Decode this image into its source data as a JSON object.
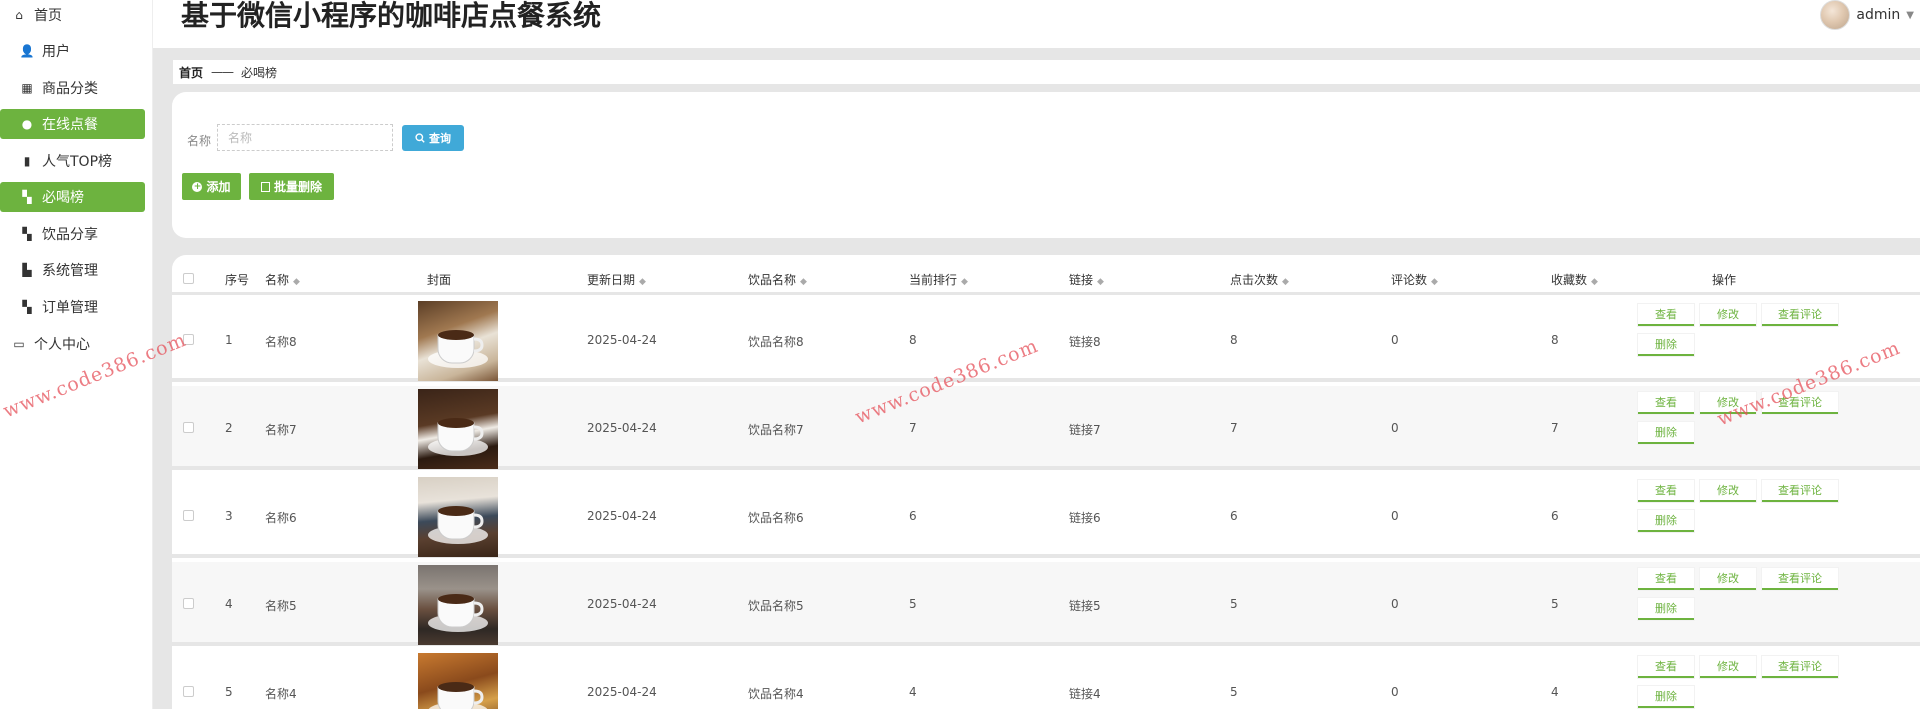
{
  "app_title": "基于微信小程序的咖啡店点餐系统",
  "user": {
    "name": "admin"
  },
  "sidebar": {
    "items": [
      {
        "label": "首页",
        "icon": "home-icon",
        "glyph": "⌂",
        "level": "top",
        "active": false
      },
      {
        "label": "用户",
        "icon": "user-icon",
        "glyph": "👤",
        "level": "sub",
        "active": false
      },
      {
        "label": "商品分类",
        "icon": "grid-icon",
        "glyph": "▦",
        "level": "sub",
        "active": false
      },
      {
        "label": "在线点餐",
        "icon": "pin-icon",
        "glyph": "●",
        "level": "sub",
        "active": true
      },
      {
        "label": "人气TOP榜",
        "icon": "bar-chart-icon",
        "glyph": "▮",
        "level": "sub",
        "active": false
      },
      {
        "label": "必喝榜",
        "icon": "tiles-icon",
        "glyph": "▚",
        "level": "sub",
        "active": true
      },
      {
        "label": "饮品分享",
        "icon": "tiles-icon",
        "glyph": "▚",
        "level": "sub",
        "active": false
      },
      {
        "label": "系统管理",
        "icon": "chart-icon",
        "glyph": "▙",
        "level": "sub",
        "active": false
      },
      {
        "label": "订单管理",
        "icon": "tiles-icon",
        "glyph": "▚",
        "level": "sub",
        "active": false
      },
      {
        "label": "个人中心",
        "icon": "card-icon",
        "glyph": "▭",
        "level": "top",
        "active": false
      }
    ]
  },
  "breadcrumb": {
    "home": "首页",
    "separator": "——",
    "current": "必喝榜"
  },
  "search": {
    "label": "名称",
    "placeholder": "名称",
    "button": "查询"
  },
  "actions": {
    "add": "添加",
    "bulk_delete": "批量删除"
  },
  "table": {
    "headers": {
      "index": "序号",
      "name": "名称",
      "cover": "封面",
      "date": "更新日期",
      "drink": "饮品名称",
      "rank": "当前排行",
      "link": "链接",
      "clicks": "点击次数",
      "comments": "评论数",
      "favorites": "收藏数",
      "ops": "操作"
    },
    "ops_labels": {
      "view": "查看",
      "edit": "修改",
      "comments": "查看评论",
      "delete": "删除"
    },
    "rows": [
      {
        "index": "1",
        "name": "名称8",
        "date": "2025-04-24",
        "drink": "饮品名称8",
        "rank": "8",
        "link": "链接8",
        "clicks": "8",
        "comments": "0",
        "favorites": "8"
      },
      {
        "index": "2",
        "name": "名称7",
        "date": "2025-04-24",
        "drink": "饮品名称7",
        "rank": "7",
        "link": "链接7",
        "clicks": "7",
        "comments": "0",
        "favorites": "7"
      },
      {
        "index": "3",
        "name": "名称6",
        "date": "2025-04-24",
        "drink": "饮品名称6",
        "rank": "6",
        "link": "链接6",
        "clicks": "6",
        "comments": "0",
        "favorites": "6"
      },
      {
        "index": "4",
        "name": "名称5",
        "date": "2025-04-24",
        "drink": "饮品名称5",
        "rank": "5",
        "link": "链接5",
        "clicks": "5",
        "comments": "0",
        "favorites": "5"
      },
      {
        "index": "5",
        "name": "名称4",
        "date": "2025-04-24",
        "drink": "饮品名称4",
        "rank": "4",
        "link": "链接4",
        "clicks": "5",
        "comments": "0",
        "favorites": "4"
      }
    ]
  },
  "watermark": "www.code386.com",
  "colors": {
    "accent": "#6db33f",
    "search_button": "#40a9d8",
    "watermark": "#e6505a"
  }
}
